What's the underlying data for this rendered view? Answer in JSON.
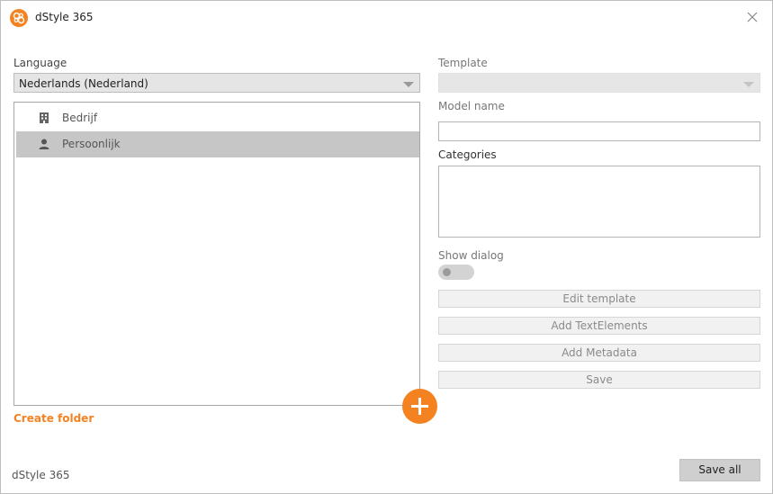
{
  "window": {
    "title": "dStyle 365",
    "logo_icon": "dstyle-logo-icon",
    "close_icon": "close-icon"
  },
  "left": {
    "language_label": "Language",
    "language_value": "Nederlands (Nederland)",
    "tree_items": [
      {
        "label": "Bedrijf",
        "icon": "building-icon",
        "selected": false
      },
      {
        "label": "Persoonlijk",
        "icon": "person-icon",
        "selected": true
      }
    ],
    "create_folder_label": "Create folder",
    "add_icon": "plus-icon"
  },
  "right": {
    "template_label": "Template",
    "template_value": "",
    "model_name_label": "Model name",
    "model_name_value": "",
    "categories_label": "Categories",
    "categories_value": "",
    "show_dialog_label": "Show dialog",
    "show_dialog_on": false,
    "buttons": {
      "edit_template": "Edit template",
      "add_text_elements": "Add TextElements",
      "add_metadata": "Add Metadata",
      "save": "Save"
    }
  },
  "footer": {
    "app_name": "dStyle 365",
    "save_all_label": "Save all"
  },
  "colors": {
    "accent": "#f58220",
    "selected_row": "#c6c6c6"
  }
}
